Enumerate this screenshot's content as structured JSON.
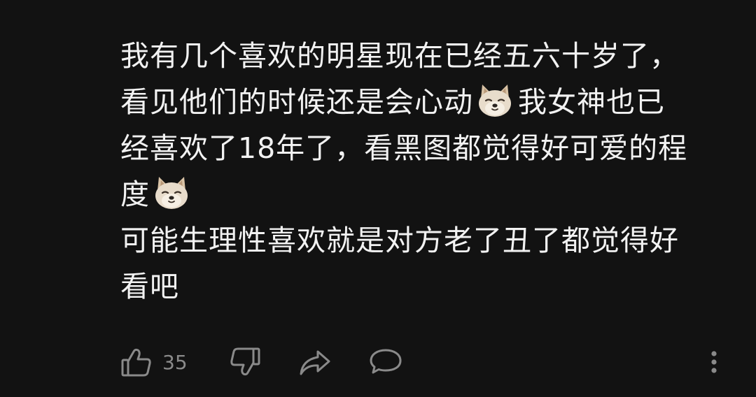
{
  "comment": {
    "lines": [
      {
        "text": "我有几个喜欢的明星现在已经五六十岁了，",
        "emoji_after": ""
      },
      {
        "text": "看见他们的时候还是会心动",
        "emoji_after": "doge-face-icon",
        "text_after": "我女神也已"
      },
      {
        "text": "经喜欢了18年了，看黑图都觉得好可爱的程",
        "emoji_after": ""
      },
      {
        "text": "度",
        "emoji_after": "doge-face-icon"
      },
      {
        "text": "可能生理性喜欢就是对方老了丑了都觉得好",
        "emoji_after": ""
      },
      {
        "text": "看吧",
        "emoji_after": ""
      }
    ]
  },
  "actions": {
    "like_icon": "thumbs-up-icon",
    "like_count": "35",
    "dislike_icon": "thumbs-down-icon",
    "share_icon": "share-arrow-icon",
    "reply_icon": "comment-bubble-icon",
    "more_icon": "vertical-dots-icon"
  },
  "colors": {
    "background": "#121212",
    "text": "#f2f2f2",
    "icon": "#8a8a8a"
  }
}
